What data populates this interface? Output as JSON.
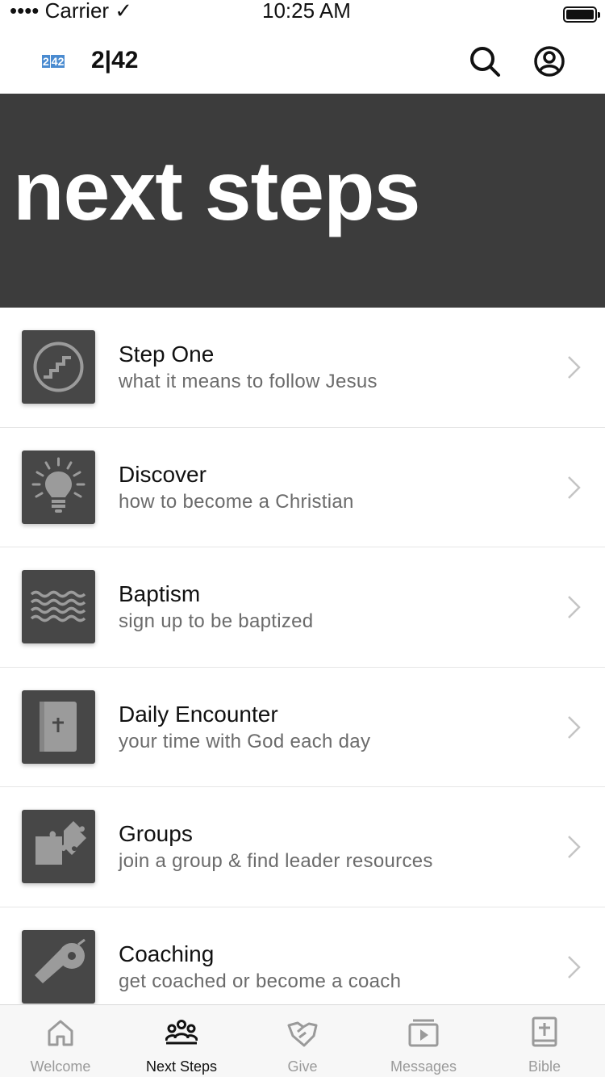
{
  "status_bar": {
    "carrier": "•••• Carrier ✓",
    "time": "10:25 AM"
  },
  "header": {
    "logo_left": "2",
    "logo_right": "42",
    "app_name": "2|42"
  },
  "hero": {
    "title": "next steps"
  },
  "items": [
    {
      "title": "Step One",
      "subtitle": "what it means to follow Jesus",
      "icon": "stairs-icon"
    },
    {
      "title": "Discover",
      "subtitle": "how to become a Christian",
      "icon": "lightbulb-icon"
    },
    {
      "title": "Baptism",
      "subtitle": "sign up to be baptized",
      "icon": "water-waves-icon"
    },
    {
      "title": "Daily Encounter",
      "subtitle": "your time with God each day",
      "icon": "bible-icon"
    },
    {
      "title": "Groups",
      "subtitle": "join a group & find leader resources",
      "icon": "puzzle-icon"
    },
    {
      "title": "Coaching",
      "subtitle": "get coached or become a coach",
      "icon": "whistle-icon"
    }
  ],
  "tabs": [
    {
      "label": "Welcome",
      "icon": "home-icon",
      "active": false
    },
    {
      "label": "Next Steps",
      "icon": "people-icon",
      "active": true
    },
    {
      "label": "Give",
      "icon": "handshake-icon",
      "active": false
    },
    {
      "label": "Messages",
      "icon": "video-play-icon",
      "active": false
    },
    {
      "label": "Bible",
      "icon": "bible-cross-icon",
      "active": false
    }
  ],
  "colors": {
    "hero_background": "#3c3c3c",
    "thumb_background": "#474747",
    "logo_blue": "#4a8bd0",
    "tab_inactive": "#9a9a9a",
    "tab_active": "#111111"
  }
}
